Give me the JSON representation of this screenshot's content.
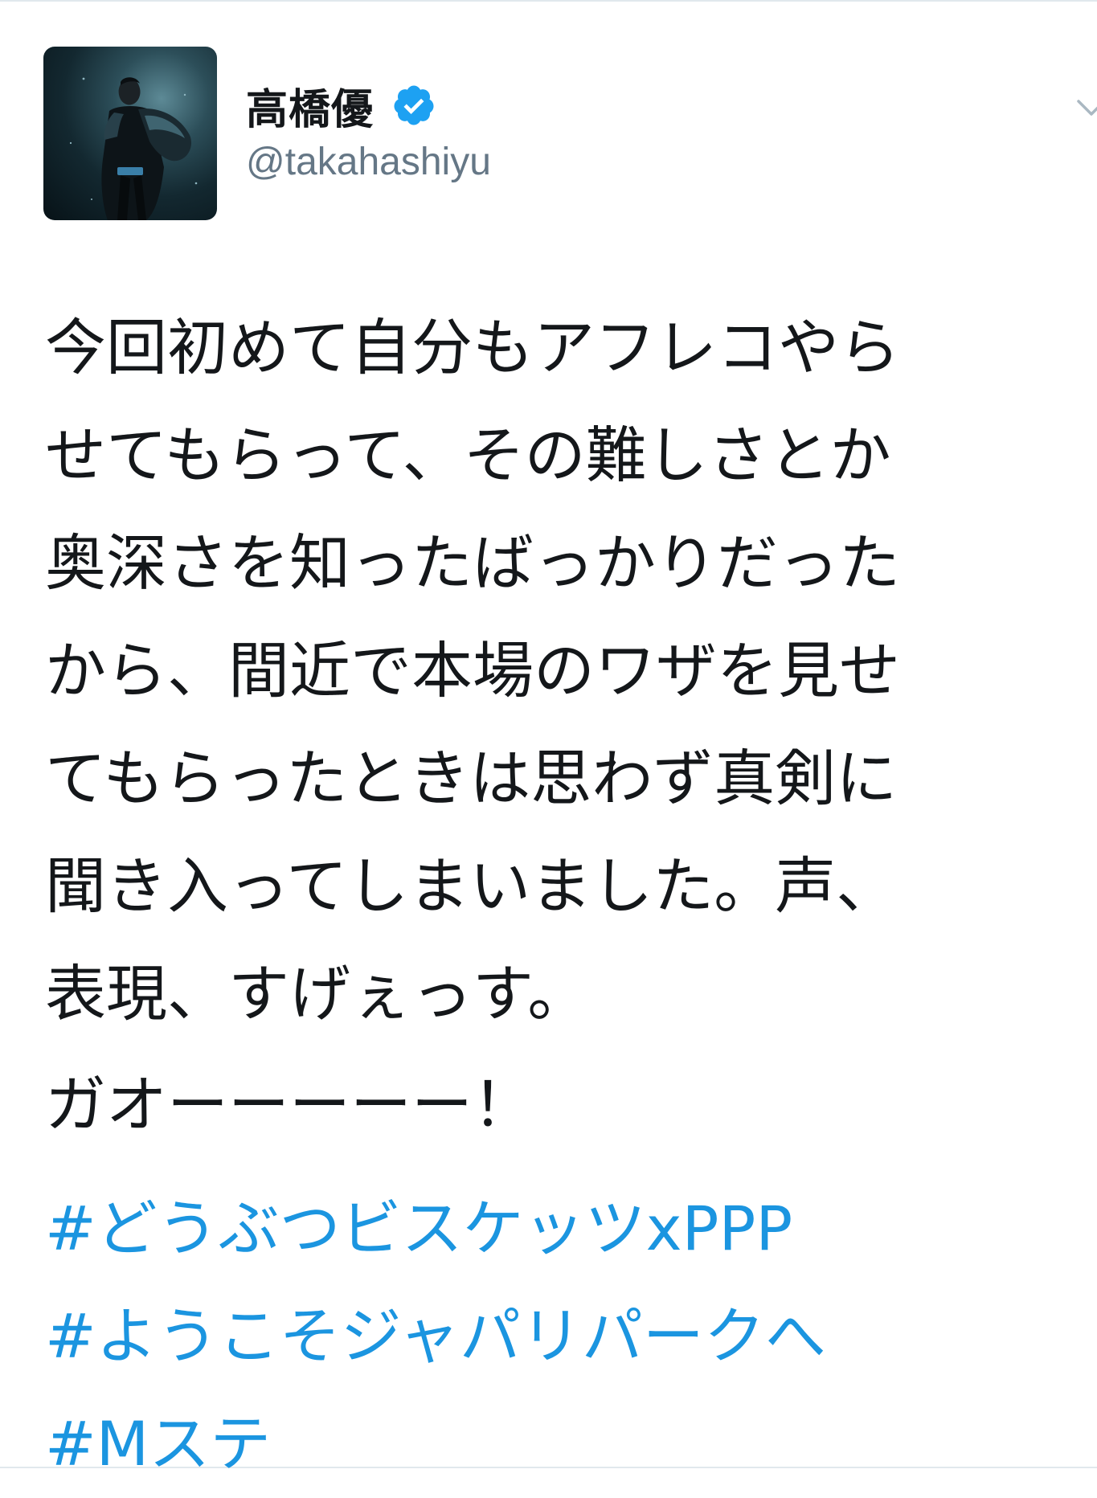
{
  "author": {
    "display_name": "高橋優",
    "handle": "@takahashiyu",
    "verified": true
  },
  "tweet": {
    "text_lines": [
      "今回初めて自分もアフレコやら",
      "せてもらって、その難しさとか",
      "奥深さを知ったばっかりだった",
      "から、間近で本場のワザを見せ",
      "てもらったときは思わず真剣に",
      "聞き入ってしまいました。声、",
      "表現、すげぇっす。"
    ],
    "shout": "ガオーーーーー！",
    "hashtags": [
      "#どうぶつビスケッツxPPP",
      "#ようこそジャパリパークへ",
      "#Mステ"
    ]
  },
  "icons": {
    "verified": "verified-badge-icon",
    "menu": "chevron-down-icon"
  },
  "colors": {
    "text": "#14171a",
    "secondary_text": "#657786",
    "link": "#1b95e0",
    "verified": "#1da1f2"
  }
}
